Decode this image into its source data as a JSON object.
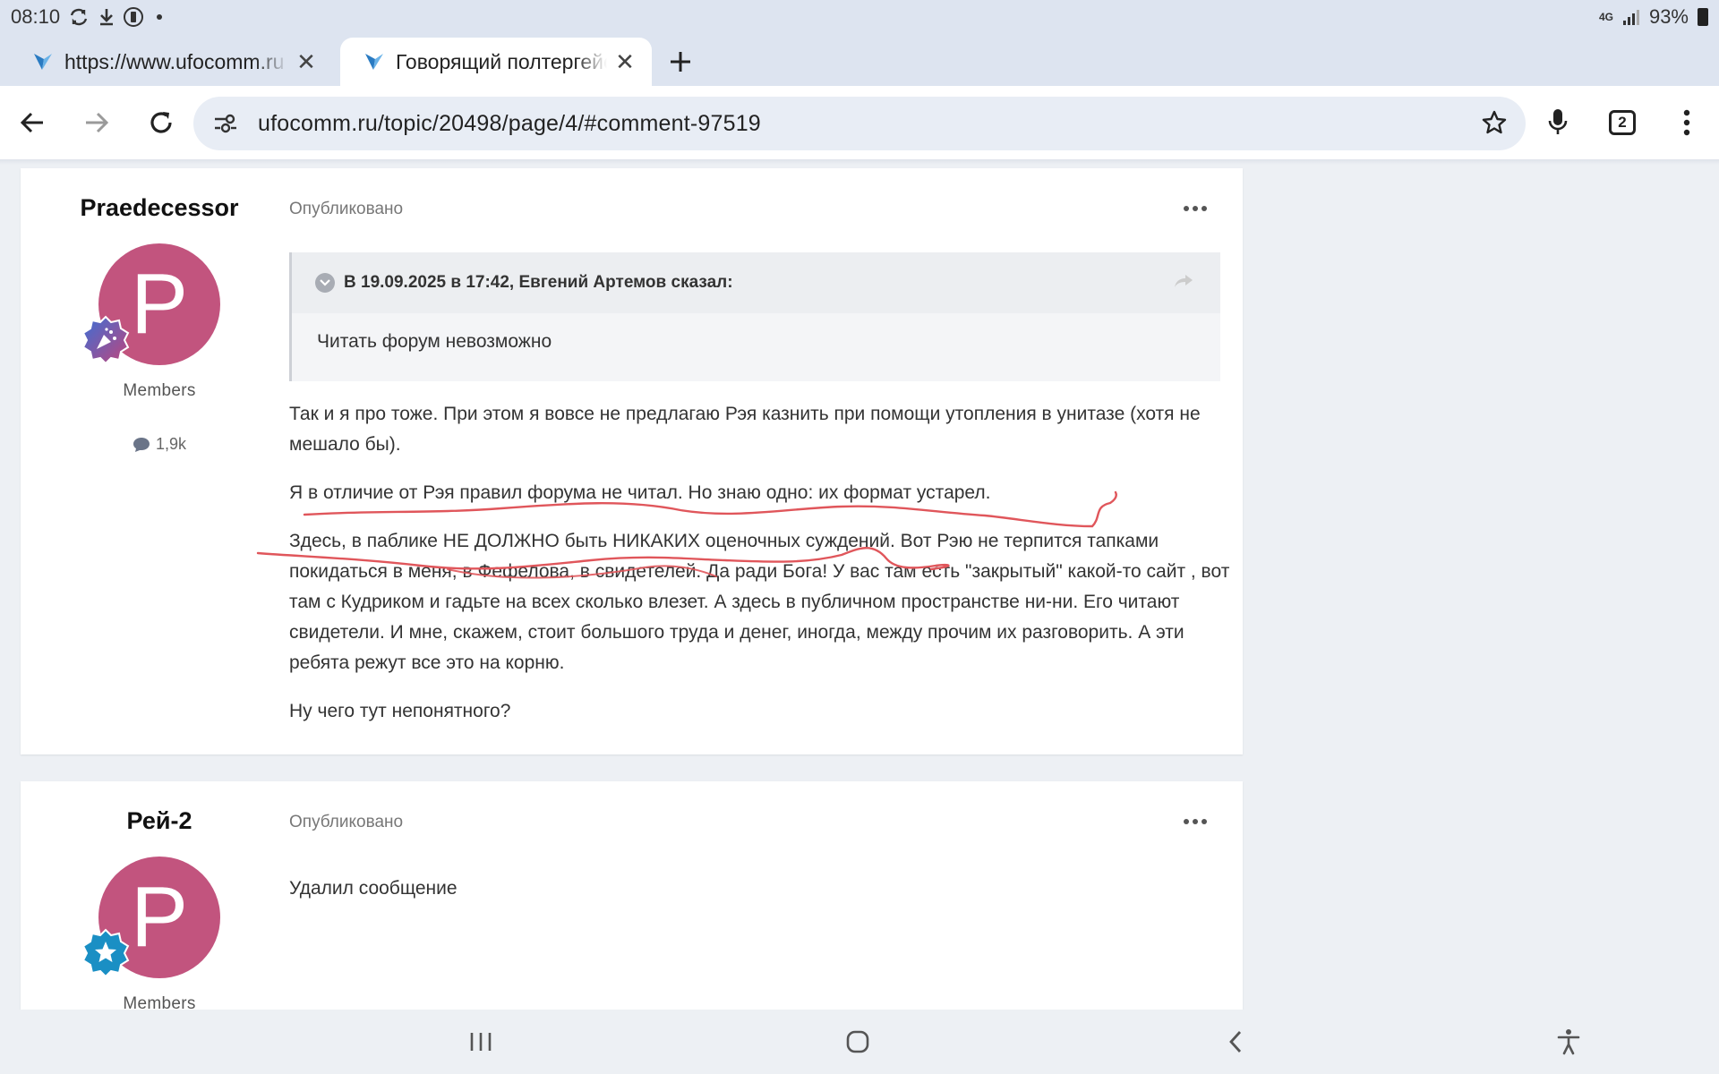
{
  "status_bar": {
    "time": "08:10",
    "network": "4G",
    "battery": "93%"
  },
  "tabs": [
    {
      "title": "https://www.ufocomm.ru",
      "active": false
    },
    {
      "title": "Говорящий полтергейст",
      "active": true
    }
  ],
  "toolbar": {
    "url": "ufocomm.ru/topic/20498/page/4/#comment-97519",
    "tab_count": "2"
  },
  "posts": [
    {
      "author": "Praedecessor",
      "avatar_letter": "P",
      "group": "Members",
      "post_count": "1,9k",
      "meta": "Опубликовано",
      "quote": {
        "header": "В 19.09.2025 в 17:42, Евгений Артемов сказал:",
        "text": "Читать форум невозможно"
      },
      "paragraphs": [
        "Так и я про тоже. При этом я вовсе не предлагаю Рэя казнить при помощи утопления в унитазе (хотя не мешало бы).",
        "Я в отличие от Рэя правил форума не читал. Но знаю одно: их формат устарел.",
        "Здесь, в паблике НЕ ДОЛЖНО быть НИКАКИХ оценочных суждений. Вот Рэю не терпится тапками покидаться в меня, в Фефелова, в свидетелей. Да ради Бога! У вас там есть \"закрытый\" какой-то сайт , вот там с Кудриком и гадьте на всех сколько влезет. А здесь в публичном пространстве ни-ни. Его читают свидетели. И мне, скажем, стоит большого труда и денег, иногда, между прочим их разговорить. А эти ребята режут все это на корню.",
        "Ну чего тут непонятного?"
      ]
    },
    {
      "author": "Рей-2",
      "avatar_letter": "P",
      "group": "Members",
      "meta": "Опубликовано",
      "paragraphs": [
        "Удалил сообщение"
      ]
    }
  ],
  "colors": {
    "avatar": "#c2547e",
    "annotation": "#e0565b",
    "badge_blue": "#1a8fc4"
  },
  "icons": [
    "sync-icon",
    "download-icon",
    "vibrate-icon",
    "signal-icon",
    "battery-icon",
    "back-icon",
    "forward-icon",
    "reload-icon",
    "site-settings-icon",
    "star-icon",
    "mic-icon",
    "tab-switcher-icon",
    "menu-icon",
    "recents-icon",
    "home-icon",
    "nav-back-icon",
    "accessibility-icon"
  ]
}
